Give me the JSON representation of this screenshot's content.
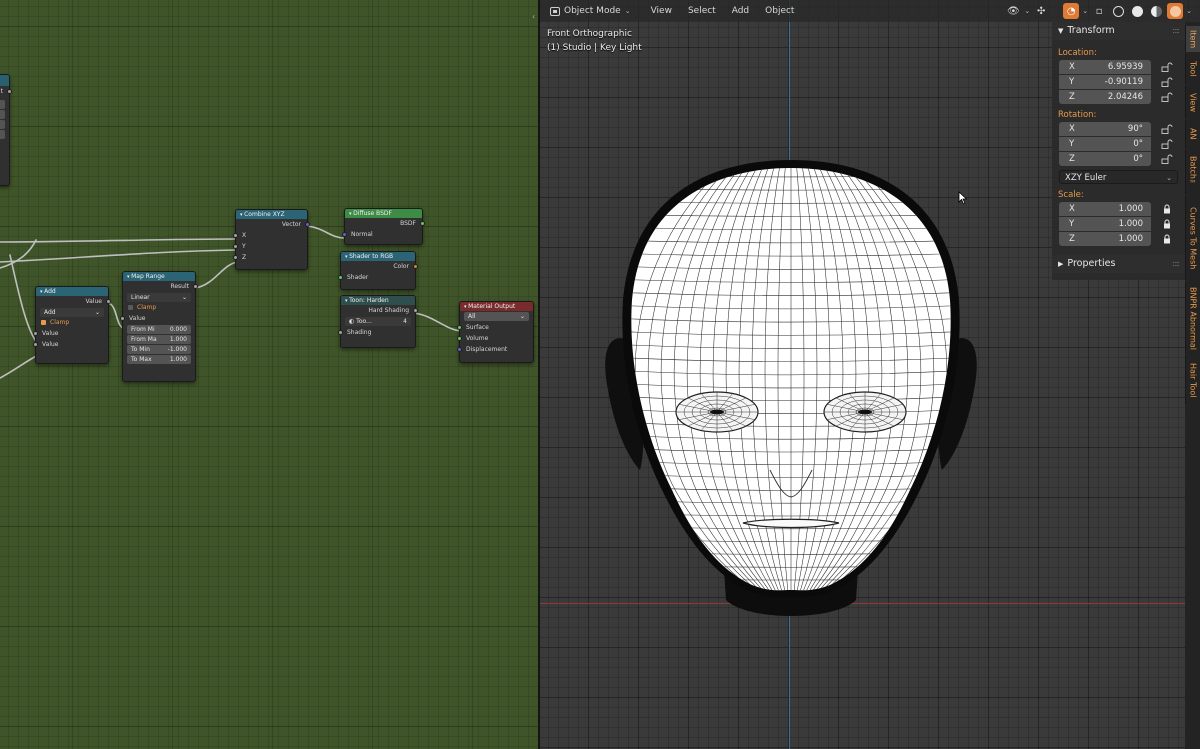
{
  "node_editor": {
    "partial_node": {
      "socket_label": "t"
    },
    "nodes": {
      "combine_xyz": {
        "title": "Combine XYZ",
        "output": "Vector",
        "inputs": [
          "X",
          "Y",
          "Z"
        ]
      },
      "diffuse_bsdf": {
        "title": "Diffuse BSDF",
        "output": "BSDF",
        "input": "Normal"
      },
      "shader_to_rgb": {
        "title": "Shader to RGB",
        "output": "Color",
        "input": "Shader"
      },
      "toon_harden": {
        "title": "Toon: Harden",
        "output": "Hard Shading",
        "field_label": "Too...",
        "field_value": "4",
        "input": "Shading"
      },
      "material_output": {
        "title": "Material Output",
        "target": "All",
        "inputs": [
          "Surface",
          "Volume",
          "Displacement"
        ]
      },
      "map_range": {
        "title": "Map Range",
        "output": "Result",
        "interpolation": "Linear",
        "clamp_label": "Clamp",
        "input": "Value",
        "fields": [
          {
            "label": "From Mi",
            "value": "0.000"
          },
          {
            "label": "From Ma",
            "value": "1.000"
          },
          {
            "label": "To Min",
            "value": "-1.000"
          },
          {
            "label": "To Max",
            "value": "1.000"
          }
        ]
      },
      "add": {
        "title": "Add",
        "output": "Value",
        "operation": "Add",
        "clamp_label": "Clamp",
        "inputs": [
          "Value",
          "Value"
        ]
      }
    }
  },
  "viewport": {
    "header": {
      "mode": "Object Mode",
      "menus": [
        "View",
        "Select",
        "Add",
        "Object"
      ]
    },
    "overlay_title": "Front Orthographic",
    "overlay_subtitle": "(1) Studio | Key Light",
    "colors": {
      "x_axis": "#8f3a3a",
      "z_axis": "#3e6f97",
      "accent": "#e07a35",
      "label": "#e79a4d"
    }
  },
  "n_panel": {
    "transform_title": "Transform",
    "location_label": "Location:",
    "location": [
      {
        "axis": "X",
        "value": "6.95939"
      },
      {
        "axis": "Y",
        "value": "-0.90119"
      },
      {
        "axis": "Z",
        "value": "2.04246"
      }
    ],
    "rotation_label": "Rotation:",
    "rotation": [
      {
        "axis": "X",
        "value": "90°"
      },
      {
        "axis": "Y",
        "value": "0°"
      },
      {
        "axis": "Z",
        "value": "0°"
      }
    ],
    "rotation_mode": "XZY Euler",
    "scale_label": "Scale:",
    "scale": [
      {
        "axis": "X",
        "value": "1.000"
      },
      {
        "axis": "Y",
        "value": "1.000"
      },
      {
        "axis": "Z",
        "value": "1.000"
      }
    ],
    "properties_title": "Properties"
  },
  "side_tabs": [
    "Item",
    "Tool",
    "View",
    "AN",
    "Batch™",
    "Curves To Mesh",
    "BNPR Abnormal",
    "Hair Tool"
  ]
}
